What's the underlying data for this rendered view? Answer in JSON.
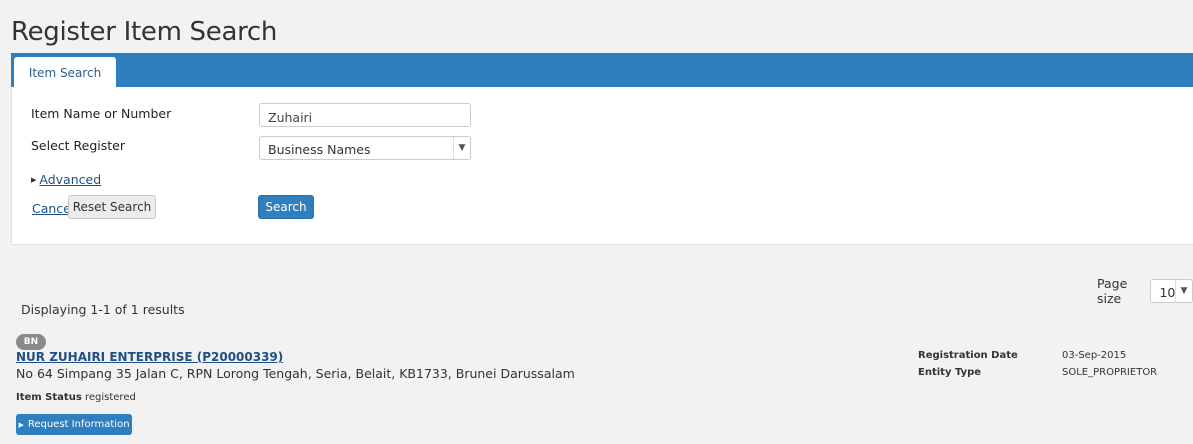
{
  "page": {
    "title": "Register Item Search"
  },
  "tabs": [
    {
      "label": "Item Search"
    }
  ],
  "form": {
    "item_name_label": "Item Name or Number",
    "item_name_value": "Zuhairi",
    "register_label": "Select Register",
    "register_value": "Business Names",
    "advanced_label": "Advanced",
    "cancel_label": "Cancel",
    "reset_label": "Reset Search",
    "search_label": "Search"
  },
  "results": {
    "page_size_label": "Page size",
    "page_size_value": "10",
    "summary": "Displaying 1-1 of 1 results",
    "items": [
      {
        "badge": "BN",
        "name": "NUR ZUHAIRI ENTERPRISE (P20000339)",
        "address": "No 64 Simpang 35 Jalan C, RPN Lorong Tengah, Seria, Belait, KB1733, Brunei Darussalam",
        "status_label": "Item Status",
        "status_value": "registered",
        "request_label": "Request Information",
        "registration_date_label": "Registration Date",
        "registration_date_value": "03-Sep-2015",
        "entity_type_label": "Entity Type",
        "entity_type_value": "SOLE_PROPRIETOR"
      }
    ]
  },
  "colors": {
    "accent": "#2f7fbf",
    "link": "#1f4f86",
    "badge": "#8a8a8a"
  },
  "icons": {
    "caret": "caret-right-icon",
    "dropdown": "chevron-down-icon"
  }
}
